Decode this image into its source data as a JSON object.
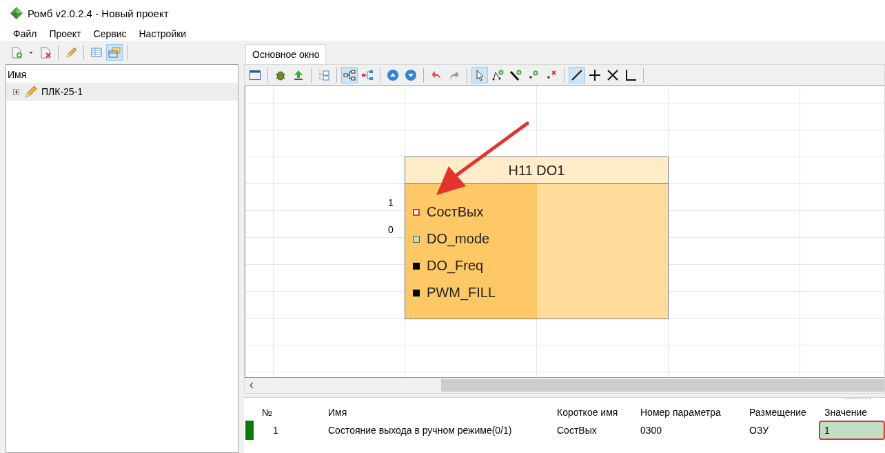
{
  "window": {
    "title": "Ромб v2.0.2.4 - Новый проект"
  },
  "menu": [
    "Файл",
    "Проект",
    "Сервис",
    "Настройки"
  ],
  "left_toolbar": [
    {
      "kind": "new-doc",
      "selected": false
    },
    {
      "kind": "dropdown",
      "selected": false
    },
    {
      "kind": "delete-doc",
      "selected": false
    },
    {
      "kind": "separator"
    },
    {
      "kind": "pencil",
      "selected": false
    },
    {
      "kind": "separator"
    },
    {
      "kind": "table",
      "selected": false
    },
    {
      "kind": "form",
      "selected": true
    },
    {
      "kind": "separator"
    }
  ],
  "tree": {
    "header": "Имя",
    "items": [
      {
        "label": "ПЛК-25-1",
        "expanded": false,
        "selected": true
      }
    ]
  },
  "tabs": [
    {
      "label": "Основное окно",
      "selected": true
    }
  ],
  "toolbar": [
    {
      "kind": "window",
      "selected": false
    },
    {
      "kind": "separator"
    },
    {
      "kind": "bug",
      "selected": false
    },
    {
      "kind": "upload",
      "selected": false
    },
    {
      "kind": "separator"
    },
    {
      "kind": "tree-doc",
      "selected": false
    },
    {
      "kind": "separator"
    },
    {
      "kind": "graph",
      "selected": true
    },
    {
      "kind": "share",
      "selected": false
    },
    {
      "kind": "separator"
    },
    {
      "kind": "up",
      "selected": false
    },
    {
      "kind": "down",
      "selected": false
    },
    {
      "kind": "separator"
    },
    {
      "kind": "undo",
      "selected": false
    },
    {
      "kind": "redo",
      "selected": false
    },
    {
      "kind": "separator"
    },
    {
      "kind": "pointer",
      "selected": true
    },
    {
      "kind": "add-node",
      "selected": false
    },
    {
      "kind": "add-line",
      "selected": false
    },
    {
      "kind": "add-point",
      "selected": false
    },
    {
      "kind": "remove-point",
      "selected": false
    },
    {
      "kind": "separator"
    },
    {
      "kind": "line",
      "selected": true
    },
    {
      "kind": "plus",
      "selected": false
    },
    {
      "kind": "cross",
      "selected": false
    },
    {
      "kind": "corner",
      "selected": false
    },
    {
      "kind": "separator"
    }
  ],
  "block": {
    "title": "H11 DO1",
    "ports": [
      {
        "label": "СостВых",
        "value": "1",
        "kind": "outlined",
        "color": "#e03131"
      },
      {
        "label": "DO_mode",
        "value": "0",
        "kind": "filled",
        "color": "#bcdcc6"
      },
      {
        "label": "DO_Freq",
        "kind": "filled",
        "color": "#000000"
      },
      {
        "label": "PWM_FILL",
        "kind": "filled",
        "color": "#000000"
      }
    ]
  },
  "table": {
    "columns": [
      "№",
      "Имя",
      "Короткое имя",
      "Номер параметра",
      "Размещение",
      "Значение"
    ],
    "rows": [
      {
        "color": "#0a7a0a",
        "cells": [
          "1",
          "Состояние выхода в ручном режиме(0/1)",
          "СостВых",
          "0300",
          "ОЗУ",
          "1"
        ],
        "highlighted": true
      }
    ]
  }
}
